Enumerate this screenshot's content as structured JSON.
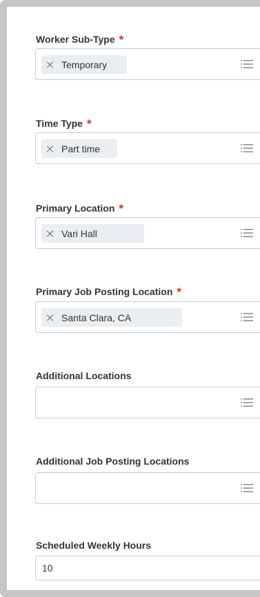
{
  "fields": [
    {
      "label": "Worker Sub-Type",
      "required": "*",
      "value": "Temporary"
    },
    {
      "label": "Time Type",
      "required": "*",
      "value": "Part time"
    },
    {
      "label": "Primary Location",
      "required": "*",
      "value": "Vari Hall"
    },
    {
      "label": "Primary Job Posting Location",
      "required": "*",
      "value": "Santa Clara, CA"
    },
    {
      "label": "Additional Locations"
    },
    {
      "label": "Additional Job Posting Locations"
    }
  ],
  "hours": {
    "label": "Scheduled Weekly Hours",
    "value": "10"
  },
  "icons": {
    "remove": "close-icon",
    "prompt": "list-icon"
  },
  "colors": {
    "required": "#de2e21",
    "pill": "#e9eef2",
    "border": "#c8cbce"
  }
}
